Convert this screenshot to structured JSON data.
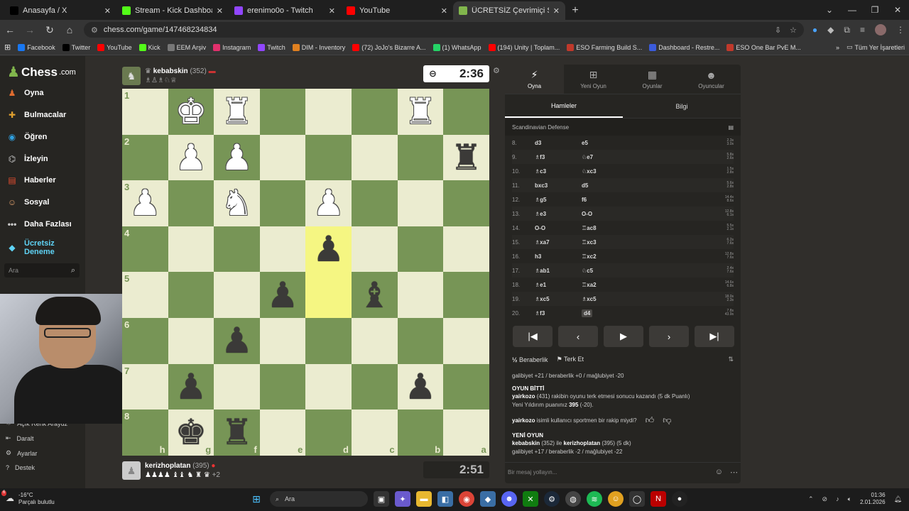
{
  "browser": {
    "tabs": [
      {
        "title": "Anasayfa / X",
        "color": "#000000",
        "icon": "x-icon",
        "active": false
      },
      {
        "title": "Stream - Kick Dashboard",
        "color": "#53fc18",
        "icon": "kick-icon",
        "active": false
      },
      {
        "title": "erenimo0o - Twitch",
        "color": "#9146ff",
        "icon": "twitch-icon",
        "active": false
      },
      {
        "title": "YouTube",
        "color": "#ff0000",
        "icon": "youtube-icon",
        "active": false
      },
      {
        "title": "ÜCRETSİZ Çevrimiçi Satranç Oy",
        "color": "#81b64c",
        "icon": "chess-icon",
        "active": true
      }
    ],
    "url": "chess.com/game/147468234834",
    "bookmarks": [
      {
        "label": "Facebook",
        "color": "#1877f2"
      },
      {
        "label": "Twitter",
        "color": "#000000"
      },
      {
        "label": "YouTube",
        "color": "#ff0000"
      },
      {
        "label": "Kick",
        "color": "#53fc18"
      },
      {
        "label": "EEM Arşiv",
        "color": "#777777"
      },
      {
        "label": "Instagram",
        "color": "#e1306c"
      },
      {
        "label": "Twitch",
        "color": "#9146ff"
      },
      {
        "label": "DIM - Inventory",
        "color": "#e08020"
      },
      {
        "label": "(72) JoJo's Bizarre A...",
        "color": "#ff0000"
      },
      {
        "label": "(1) WhatsApp",
        "color": "#25d366"
      },
      {
        "label": "(194) Unity | Toplam...",
        "color": "#ff0000"
      },
      {
        "label": "ESO Farming Build S...",
        "color": "#c0392b"
      },
      {
        "label": "Dashboard - Restre...",
        "color": "#3b5bdb"
      },
      {
        "label": "ESO One Bar PvE M...",
        "color": "#c0392b"
      }
    ],
    "all_bookmarks": "Tüm Yer İşaretleri"
  },
  "sidebar": {
    "logo": "Chess",
    "logo_suffix": ".com",
    "items": [
      {
        "label": "Oyna",
        "icon": "play-icon",
        "color": "#e06c2f"
      },
      {
        "label": "Bulmacalar",
        "icon": "puzzle-icon",
        "color": "#e0a02f"
      },
      {
        "label": "Öğren",
        "icon": "learn-icon",
        "color": "#2fa0e0"
      },
      {
        "label": "İzleyin",
        "icon": "binoculars-icon",
        "color": "#cccccc"
      },
      {
        "label": "Haberler",
        "icon": "news-icon",
        "color": "#e04c2f"
      },
      {
        "label": "Sosyal",
        "icon": "social-icon",
        "color": "#e0a06c"
      },
      {
        "label": "Daha Fazlası",
        "icon": "more-icon",
        "color": "#cccccc"
      },
      {
        "label": "Ücretsiz Deneme",
        "icon": "diamond-icon",
        "color": "#5fd3f5"
      }
    ],
    "search_placeholder": "Ara",
    "bottom_items": [
      {
        "label": "Açık Renk Arayüz",
        "icon": "light-icon"
      },
      {
        "label": "Daralt",
        "icon": "collapse-icon"
      },
      {
        "label": "Ayarlar",
        "icon": "settings-icon"
      },
      {
        "label": "Destek",
        "icon": "help-icon"
      }
    ]
  },
  "game": {
    "top_player": {
      "name": "kebabskin",
      "rating": "(352)",
      "captures": "♗♙♗♘♕",
      "clock": "2:36"
    },
    "bottom_player": {
      "name": "kerizhoplatan",
      "rating": "(395)",
      "captures": "♟♟♟♟ ♝♝ ♞ ♜ ♛",
      "extra": "+2",
      "clock": "2:51"
    },
    "ranks": [
      "1",
      "2",
      "3",
      "4",
      "5",
      "6",
      "7",
      "8"
    ],
    "files": [
      "h",
      "g",
      "f",
      "e",
      "d",
      "c",
      "b",
      "a"
    ],
    "highlight": [
      "3,4",
      "4,4"
    ],
    "pieces": {
      "0,1": "wK",
      "0,2": "wR",
      "0,6": "wR",
      "1,1": "wP",
      "1,2": "wP",
      "1,7": "bR",
      "2,0": "wP",
      "2,2": "wN",
      "2,4": "wP",
      "3,4": "bP",
      "4,3": "bP",
      "4,5": "bB",
      "5,2": "bP",
      "6,1": "bP",
      "6,6": "bP",
      "7,1": "bK",
      "7,2": "bR"
    }
  },
  "panel": {
    "tabs": [
      {
        "label": "Oyna",
        "icon": "bolt-icon"
      },
      {
        "label": "Yeni Oyun",
        "icon": "plus-icon"
      },
      {
        "label": "Oyunlar",
        "icon": "board-icon"
      },
      {
        "label": "Oyuncular",
        "icon": "players-icon"
      }
    ],
    "subtabs": [
      "Hamleler",
      "Bilgi"
    ],
    "opening": "Scandinavian Defense",
    "moves": [
      {
        "n": "8.",
        "w": "d3",
        "b": "e5",
        "t1": "2.3s",
        "t2": "3.0s"
      },
      {
        "n": "9.",
        "w": "♗f3",
        "b": "♘e7",
        "t1": "5.8s",
        "t2": "2.6s"
      },
      {
        "n": "10.",
        "w": "♗c3",
        "b": "♘xc3",
        "t1": "1.5s",
        "t2": "2.8s"
      },
      {
        "n": "11.",
        "w": "bxc3",
        "b": "d5",
        "t1": "5.6s",
        "t2": "2.8s"
      },
      {
        "n": "12.",
        "w": "♗g5",
        "b": "f6",
        "t1": "14.4s",
        "t2": "8.6s"
      },
      {
        "n": "13.",
        "w": "♗e3",
        "b": "O-O",
        "t1": "12.8s",
        "t2": "6.1s"
      },
      {
        "n": "14.",
        "w": "O-O",
        "b": "♖ac8",
        "t1": "5.5s",
        "t2": "2.1s"
      },
      {
        "n": "15.",
        "w": "♗xa7",
        "b": "♖xc3",
        "t1": "6.2s",
        "t2": "7.6s"
      },
      {
        "n": "16.",
        "w": "h3",
        "b": "♖xc2",
        "t1": "12.8s",
        "t2": "7.6s"
      },
      {
        "n": "17.",
        "w": "♗ab1",
        "b": "♘c5",
        "t1": "2.4s",
        "t2": "7.6s"
      },
      {
        "n": "18.",
        "w": "♗e1",
        "b": "♖xa2",
        "t1": "14.6s",
        "t2": "6.8s"
      },
      {
        "n": "19.",
        "w": "♗xc5",
        "b": "♗xc5",
        "t1": "18.0s",
        "t2": "2.3s"
      },
      {
        "n": "20.",
        "w": "♗f3",
        "b": "d4",
        "t1": "7.8s",
        "t2": "43.9s"
      }
    ],
    "draw": "Beraberlik",
    "resign": "Terk Et",
    "chat": {
      "line1": "galibiyet +21 / beraberlik +0 / mağlubiyet -20",
      "game_over": "OYUN BİTTİ",
      "winner": "yairkozo",
      "winner_rest": "(431) rakibin oyunu terk etmesi sonucu kazandı (5 dk Puanlı)",
      "new_rating_pre": "Yeni Yıldırım puanınız",
      "new_rating": "395",
      "new_rating_post": "(-20).",
      "question_user": "yairkozo",
      "question_rest": "isimli kullanıcı sportmen bir rakip miydi?",
      "new_game": "YENİ OYUN",
      "ng_p1": "kebabskin",
      "ng_mid1": "(352) ile",
      "ng_p2": "kerizhoplatan",
      "ng_mid2": "(395) (5 dk)",
      "line_last": "galibiyet +17 / beraberlik -2 / mağlubiyet -22"
    },
    "chat_placeholder": "Bir mesaj yollayın..."
  },
  "taskbar": {
    "temp": "-16°C",
    "weather": "Parçalı bulutlu",
    "badge": "6",
    "search": "Ara",
    "time": "01:36",
    "date": "2.01.2026"
  }
}
